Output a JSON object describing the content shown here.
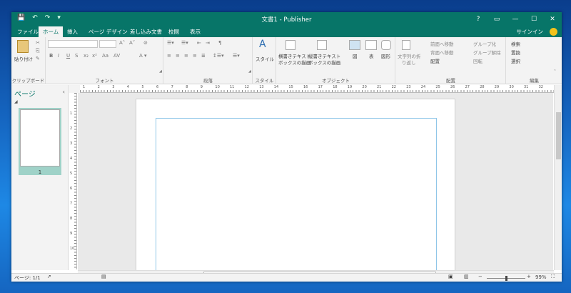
{
  "window": {
    "title": "文書1 - Publisher",
    "help_label": "?",
    "minimize_label": "—",
    "maximize_label": "☐",
    "close_label": "✕"
  },
  "tabs": [
    {
      "label": "ファイル"
    },
    {
      "label": "ホーム"
    },
    {
      "label": "挿入"
    },
    {
      "label": "ページ デザイン"
    },
    {
      "label": "差し込み文書"
    },
    {
      "label": "校閲"
    },
    {
      "label": "表示"
    }
  ],
  "signin_label": "サインイン",
  "ribbon": {
    "clipboard": {
      "paste_label": "貼り付け",
      "group_label": "クリップボード"
    },
    "font": {
      "group_label": "フォント",
      "bold": "B",
      "italic": "I",
      "underline": "U"
    },
    "paragraph": {
      "group_label": "段落"
    },
    "style": {
      "style_label": "スタイル",
      "group_label": "スタイル"
    },
    "objects": {
      "hbox_label_1": "横書きテキスト",
      "hbox_label_2": "ボックスの描画",
      "vbox_label_1": "縦書きテキスト",
      "vbox_label_2": "ボックスの描画",
      "picture_label": "図",
      "table_label": "表",
      "shapes_label": "図形",
      "group_label": "オブジェクト"
    },
    "arrange": {
      "wrap_label_1": "文字列の折",
      "wrap_label_2": "り返し",
      "bring_forward": "前面へ移動",
      "send_backward": "背面へ移動",
      "align": "配置",
      "group": "グループ化",
      "ungroup": "グループ解除",
      "rotate": "回転",
      "group_label": "配置"
    },
    "editing": {
      "find": "検索",
      "replace": "置換",
      "select": "選択",
      "group_label": "編集"
    }
  },
  "pages_pane": {
    "title": "ページ",
    "page_number": "1"
  },
  "rulers": {
    "h_numbers": [
      "1",
      "2",
      "3",
      "4",
      "5",
      "6",
      "7",
      "8",
      "9",
      "10",
      "11",
      "12",
      "13",
      "14",
      "15",
      "16",
      "17",
      "18",
      "19",
      "20",
      "21",
      "22",
      "23",
      "24",
      "25",
      "26",
      "27",
      "28",
      "29",
      "30",
      "31",
      "32"
    ],
    "v_numbers": [
      "1",
      "2",
      "3",
      "4",
      "5",
      "6",
      "7",
      "8",
      "9",
      "10"
    ]
  },
  "status": {
    "page_info": "ページ: 1/1",
    "zoom": "99%",
    "zoom_level": 0.5
  },
  "colors": {
    "accent": "#077568"
  }
}
